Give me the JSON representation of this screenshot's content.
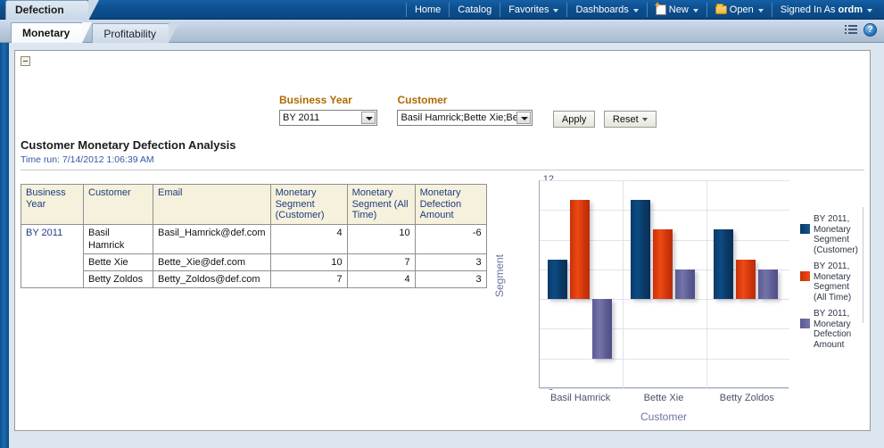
{
  "global": {
    "dashboard_tab": "Defection",
    "nav": [
      {
        "label": "Home",
        "icon": null,
        "caret": false
      },
      {
        "label": "Catalog",
        "icon": null,
        "caret": false
      },
      {
        "label": "Favorites",
        "icon": null,
        "caret": true
      },
      {
        "label": "Dashboards",
        "icon": null,
        "caret": true
      },
      {
        "label": "New",
        "icon": "new-page-icon",
        "caret": true
      },
      {
        "label": "Open",
        "icon": "folder-icon",
        "caret": true
      }
    ],
    "signed_in_as_label": "Signed In As",
    "user": "ordm"
  },
  "tabs": [
    {
      "label": "Monetary",
      "active": true
    },
    {
      "label": "Profitability",
      "active": false
    }
  ],
  "toolbar": {
    "page_options_icon": "page-options-icon",
    "help_icon": "help-icon",
    "help_glyph": "?"
  },
  "prompts": {
    "business_year": {
      "label": "Business Year",
      "value": "BY 2011"
    },
    "customer": {
      "label": "Customer",
      "value": "Basil Hamrick;Bette Xie;Bett"
    },
    "apply_label": "Apply",
    "reset_label": "Reset"
  },
  "report": {
    "title": "Customer Monetary Defection Analysis",
    "time_run": "Time run: 7/14/2012 1:06:39 AM"
  },
  "table": {
    "headers": [
      "Business Year",
      "Customer",
      "Email",
      "Monetary Segment (Customer)",
      "Monetary Segment (All Time)",
      "Monetary Defection Amount"
    ],
    "rows": [
      {
        "business_year": "BY 2011",
        "customer": "Basil Hamrick",
        "email": "Basil_Hamrick@def.com",
        "seg_customer": "4",
        "seg_alltime": "10",
        "defection": "-6"
      },
      {
        "business_year": "",
        "customer": "Bette Xie",
        "email": "Bette_Xie@def.com",
        "seg_customer": "10",
        "seg_alltime": "7",
        "defection": "3"
      },
      {
        "business_year": "",
        "customer": "Betty Zoldos",
        "email": "Betty_Zoldos@def.com",
        "seg_customer": "7",
        "seg_alltime": "4",
        "defection": "3"
      }
    ]
  },
  "chart_data": {
    "type": "bar",
    "title": "",
    "xlabel": "Customer",
    "ylabel": "Segment",
    "categories": [
      "Basil Hamrick",
      "Bette Xie",
      "Betty Zoldos"
    ],
    "series": [
      {
        "name": "BY 2011, Monetary Segment (Customer)",
        "color": "#0d4b84",
        "values": [
          4,
          10,
          7
        ]
      },
      {
        "name": "BY 2011, Monetary Segment (All Time)",
        "color": "#ee4a13",
        "values": [
          10,
          7,
          4
        ]
      },
      {
        "name": "BY 2011, Monetary Defection Amount",
        "color": "#7474a8",
        "values": [
          -6,
          3,
          3
        ]
      }
    ],
    "ylim": [
      -9,
      12
    ],
    "yticks": [
      12,
      9,
      6,
      3,
      0,
      -3,
      -6,
      -9
    ],
    "grid": true,
    "legend_position": "right"
  },
  "colors": {
    "header_blue": "#0d4f8e",
    "prompt_label": "#b06a00",
    "link_blue": "#1f3c82",
    "series_navy": "#0d4b84",
    "series_red": "#ee4a13",
    "series_purple": "#7474a8"
  }
}
